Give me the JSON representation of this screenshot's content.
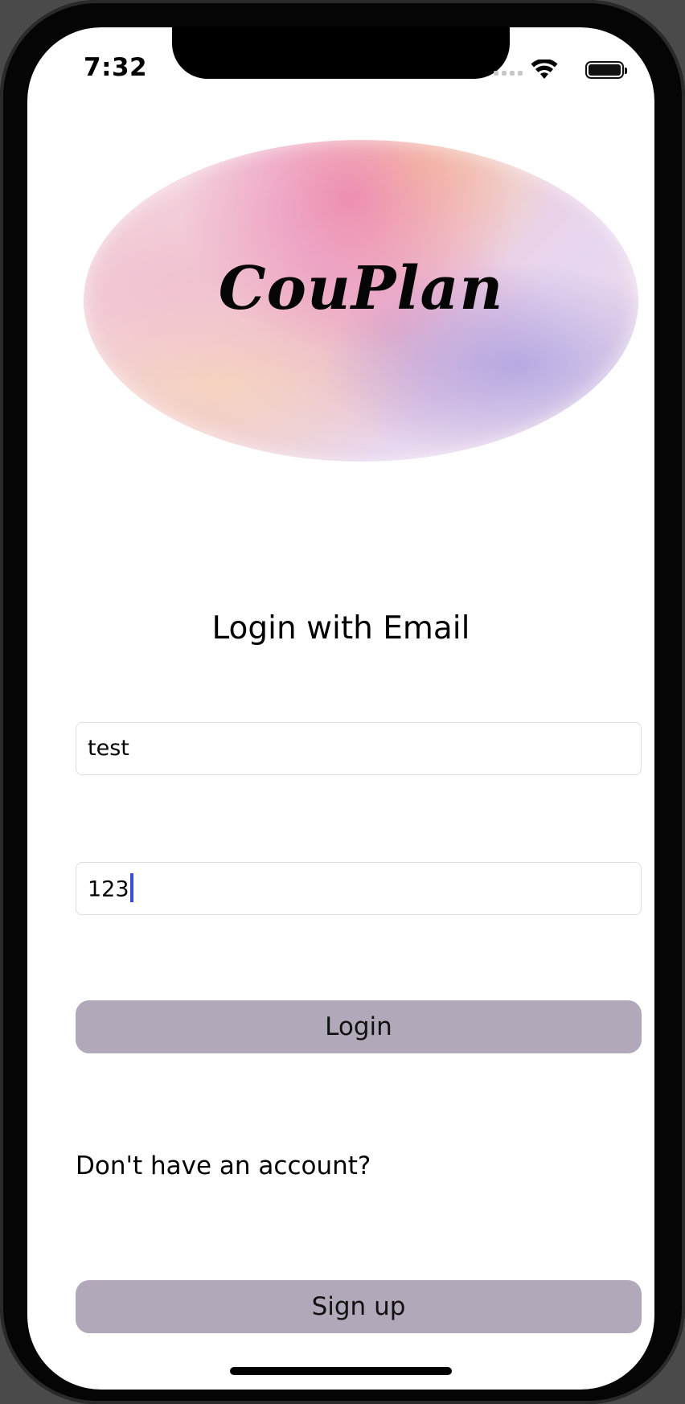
{
  "status_bar": {
    "time": "7:32",
    "icons": [
      "cellular-signal-icon",
      "wifi-icon",
      "battery-icon"
    ]
  },
  "logo": {
    "text": "CouPlan"
  },
  "page": {
    "title": "Login with Email"
  },
  "form": {
    "email_value": "test",
    "password_value": "123",
    "login_label": "Login",
    "no_account_text": "Don't have an account?",
    "signup_label": "Sign up"
  },
  "colors": {
    "button_background": "#b1a8b9",
    "caret": "#3b4cd8"
  }
}
